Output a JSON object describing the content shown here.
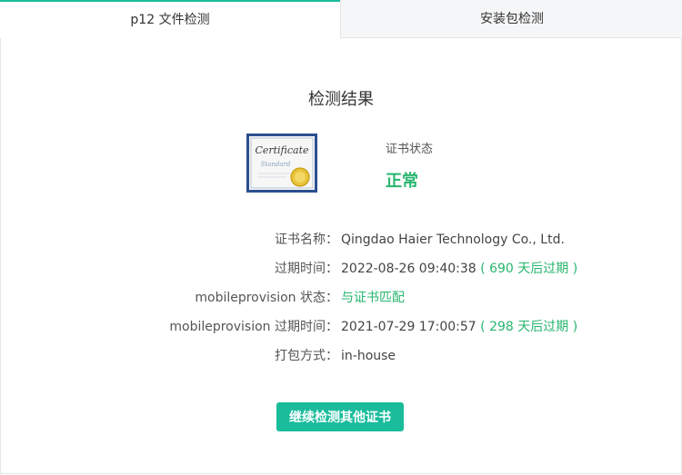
{
  "tabs": [
    {
      "label": "p12 文件检测",
      "active": true
    },
    {
      "label": "安装包检测",
      "active": false
    }
  ],
  "result": {
    "title": "检测结果",
    "cert_image_text": "Certificate",
    "cert_image_subtext": "Standard",
    "status_label": "证书状态",
    "status_value": "正常"
  },
  "info": [
    {
      "label": "证书名称：",
      "value": "Qingdao Haier Technology Co., Ltd.",
      "extra": ""
    },
    {
      "label": "过期时间：",
      "value": "2022-08-26 09:40:38",
      "extra": "( 690 天后过期 )"
    },
    {
      "label": "mobileprovision 状态：",
      "value": "与证书匹配",
      "extra": ""
    },
    {
      "label": "mobileprovision 过期时间：",
      "value": "2021-07-29 17:00:57",
      "extra": "( 298 天后过期 )"
    },
    {
      "label": "打包方式：",
      "value": "in-house",
      "extra": ""
    }
  ],
  "action": {
    "button_label": "继续检测其他证书"
  },
  "colors": {
    "accent": "#1abc9c",
    "ok_green": "#27b56e"
  }
}
